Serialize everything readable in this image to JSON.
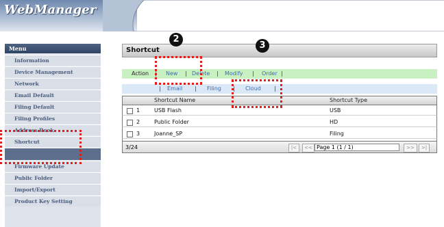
{
  "app": {
    "logo": "WebManager"
  },
  "sidebar": {
    "title": "Menu",
    "items": [
      {
        "label": "Information"
      },
      {
        "label": "Device Management"
      },
      {
        "label": "Network"
      },
      {
        "label": "Email Default"
      },
      {
        "label": "Filing Default"
      },
      {
        "label": "Filing Profiles"
      },
      {
        "label": "Address Book"
      },
      {
        "label": "Shortcut",
        "active": true
      },
      {
        "label": "Firmware Update"
      },
      {
        "label": "Public Folder"
      },
      {
        "label": "Import/Export"
      },
      {
        "label": "Product Key Setting"
      }
    ]
  },
  "main": {
    "title": "Shortcut",
    "actions": {
      "label": "Action",
      "new": "New",
      "delete": "Delete",
      "modify": "Modify",
      "order": "Order"
    },
    "categories": [
      "Email",
      "Filing",
      "Cloud"
    ],
    "table": {
      "columns": [
        "Shortcut Name",
        "Shortcut Type"
      ],
      "rows": [
        {
          "num": "1",
          "name": "USB Flash",
          "type": "USB"
        },
        {
          "num": "2",
          "name": "Public Folder",
          "type": "HD"
        },
        {
          "num": "3",
          "name": "Joanne_SP",
          "type": "Filing"
        }
      ],
      "footer": {
        "count": "3/24",
        "page": "Page 1 (1 / 1)",
        "first": "|<",
        "prev": "<<",
        "next": ">>",
        "last": ">|"
      }
    }
  },
  "callouts": {
    "m2": "2",
    "m3": "3"
  },
  "colors": {
    "highlight": "#e41b1b",
    "action_bar": "#c9f0c0",
    "category_bar": "#dbe8f7",
    "sidebar_active": "#5b6f8c"
  }
}
